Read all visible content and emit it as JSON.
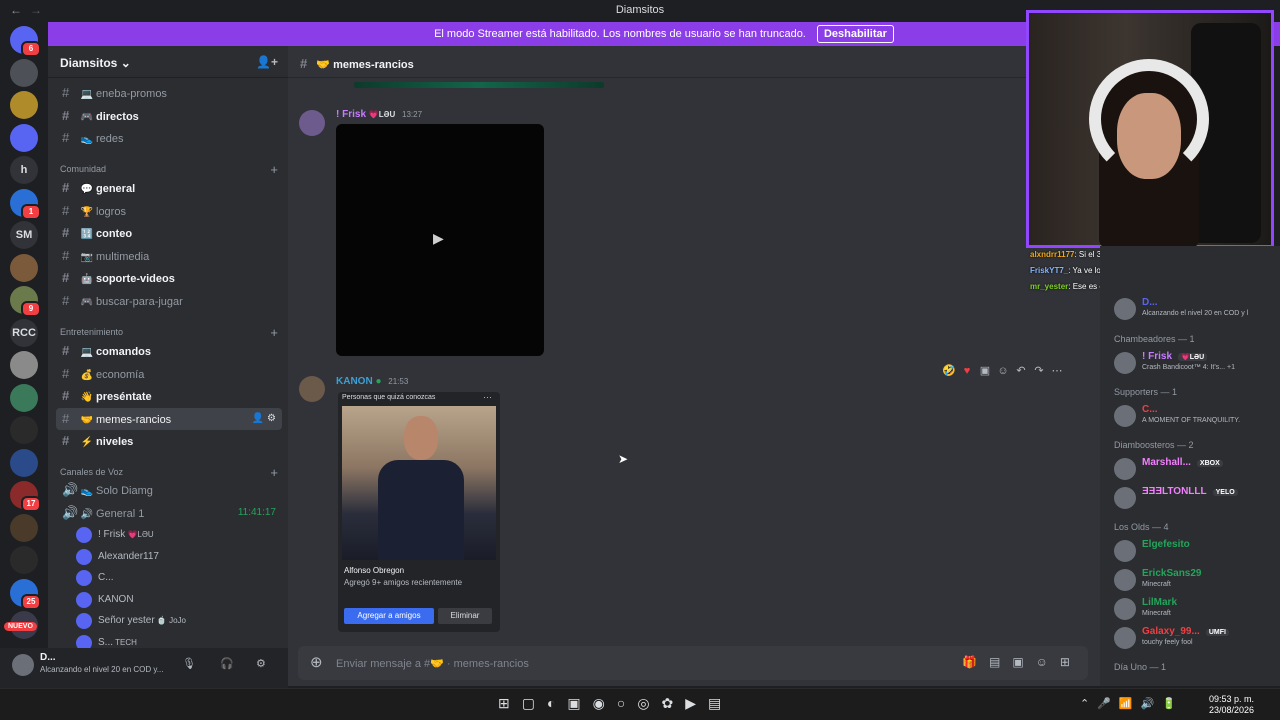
{
  "window": {
    "title": "Diamsitos"
  },
  "streamer_banner": {
    "text": "El modo Streamer está habilitado. Los nombres de usuario se han truncado.",
    "button": "Deshabilitar"
  },
  "servers": [
    {
      "label": "",
      "badge": "6"
    },
    {
      "label": "",
      "badge": ""
    },
    {
      "label": "",
      "badge": ""
    },
    {
      "label": "",
      "badge": ""
    },
    {
      "label": "h",
      "badge": ""
    },
    {
      "label": "",
      "badge": "1"
    },
    {
      "label": "SM",
      "badge": ""
    },
    {
      "label": "",
      "badge": ""
    },
    {
      "label": "",
      "badge": "9"
    },
    {
      "label": "RCC",
      "badge": ""
    },
    {
      "label": "",
      "badge": ""
    },
    {
      "label": "",
      "badge": ""
    },
    {
      "label": "",
      "badge": ""
    },
    {
      "label": "",
      "badge": ""
    },
    {
      "label": "",
      "badge": "17"
    },
    {
      "label": "",
      "badge": ""
    },
    {
      "label": "",
      "badge": ""
    },
    {
      "label": "",
      "badge": "25"
    },
    {
      "label": "",
      "badge": ""
    }
  ],
  "new_badge": "NUEVO",
  "server": {
    "name": "Diamsitos"
  },
  "channels_top": [
    {
      "name": "eneba-promos",
      "emoji": "💻",
      "unread": false
    },
    {
      "name": "directos",
      "emoji": "🎮",
      "unread": true
    },
    {
      "name": "redes",
      "emoji": "👟",
      "unread": false
    }
  ],
  "categories": {
    "comunidad": "Comunidad",
    "entretenimiento": "Entretenimiento",
    "voz": "Canales de Voz"
  },
  "channels_comunidad": [
    {
      "name": "general",
      "emoji": "💬",
      "unread": true
    },
    {
      "name": "logros",
      "emoji": "🏆",
      "unread": false
    },
    {
      "name": "conteo",
      "emoji": "🔢",
      "unread": true
    },
    {
      "name": "multimedia",
      "emoji": "📷",
      "unread": false
    },
    {
      "name": "soporte-videos",
      "emoji": "🤖",
      "unread": true
    },
    {
      "name": "buscar-para-jugar",
      "emoji": "🎮",
      "unread": false
    }
  ],
  "channels_entretenimiento": [
    {
      "name": "comandos",
      "emoji": "💻",
      "unread": true
    },
    {
      "name": "economía",
      "emoji": "💰",
      "unread": false
    },
    {
      "name": "preséntate",
      "emoji": "👋",
      "unread": true
    },
    {
      "name": "memes-rancios",
      "emoji": "🤝",
      "unread": false
    },
    {
      "name": "niveles",
      "emoji": "⚡",
      "unread": true
    }
  ],
  "voice_channels": [
    {
      "name": "Solo Diamg",
      "emoji": "👟"
    },
    {
      "name": "General 1",
      "emoji": "🔊",
      "timer": "11:41:17"
    }
  ],
  "voice_users": [
    {
      "name": "! Frisk",
      "tag": "💗LƏU"
    },
    {
      "name": "Alexander117",
      "tag": ""
    },
    {
      "name": "C...",
      "tag": ""
    },
    {
      "name": "KANON",
      "tag": ""
    },
    {
      "name": "Señor yester",
      "tag": "🍵 JoJo"
    },
    {
      "name": "S...",
      "tag": "TECH"
    }
  ],
  "bottom_user": {
    "name": "D...",
    "status": "Alcanzando el nivel 20 en COD y..."
  },
  "channel_header": {
    "name": "memes-rancios",
    "emoji": "🤝"
  },
  "messages": [
    {
      "author": "! Frisk",
      "tag": "💗LƏU",
      "time": "13:27",
      "color": "#c77dff"
    },
    {
      "author": "KANON",
      "time": "21:53",
      "color": "#3ba0d6"
    }
  ],
  "friend_card": {
    "label": "Personas que quizá conozcas",
    "name": "Alfonso Obregon",
    "desc": "Agregó 9+ amigos recientemente",
    "add": "Agregar a amigos",
    "delete": "Eliminar"
  },
  "composer": {
    "placeholder": "Enviar mensaje a #🤝 · memes-rancios"
  },
  "stream_chat": [
    {
      "user": "alxndrr1177",
      "text": ": Si el 3",
      "color": "#f3a712"
    },
    {
      "user": "FriskYT7_",
      "text": ": Ya ve los memes w",
      "color": "#8ab4f8"
    },
    {
      "user": "mr_yester",
      "text": ": Ese es el anti yester we,me cae mal",
      "color": "#7ed321"
    }
  ],
  "member_groups": [
    {
      "label": "Chambeadores — 1",
      "members": [
        {
          "name": "! Frisk",
          "tag": "💗LƏU",
          "sub": "Crash Bandicoot™ 4: It's... +1",
          "color": "#c77dff"
        }
      ]
    },
    {
      "label": "Supporters — 1",
      "members": [
        {
          "name": "C...",
          "tag": "",
          "sub": "A MOMENT OF TRANQUILITY.",
          "color": "#f23f43"
        }
      ]
    },
    {
      "label": "Diamboosteros — 2",
      "members": [
        {
          "name": "Marshall...",
          "tag": "XBOX",
          "sub": "",
          "color": "#f47fff"
        },
        {
          "name": "ƎƎƎLTONLLL",
          "tag": "YELO",
          "sub": "",
          "color": "#f47fff"
        }
      ]
    },
    {
      "label": "Los Olds — 4",
      "members": [
        {
          "name": "Elgefesito",
          "tag": "",
          "sub": "",
          "color": "#23a55a"
        },
        {
          "name": "ErickSans29",
          "tag": "",
          "sub": "Minecraft",
          "color": "#23a55a"
        },
        {
          "name": "LilMark",
          "tag": "",
          "sub": "Minecraft",
          "color": "#23a55a"
        },
        {
          "name": "Galaxy_99...",
          "tag": "UMFI",
          "sub": "touchy feely fool",
          "color": "#f23f43"
        }
      ]
    },
    {
      "label": "Día Uno — 1",
      "members": []
    }
  ],
  "member_top": {
    "name": "D...",
    "sub": "Alcanzando el nivel 20 en COD y l"
  },
  "taskbar": {
    "time": "09:53 p. m.",
    "date": "23/08/2026"
  }
}
